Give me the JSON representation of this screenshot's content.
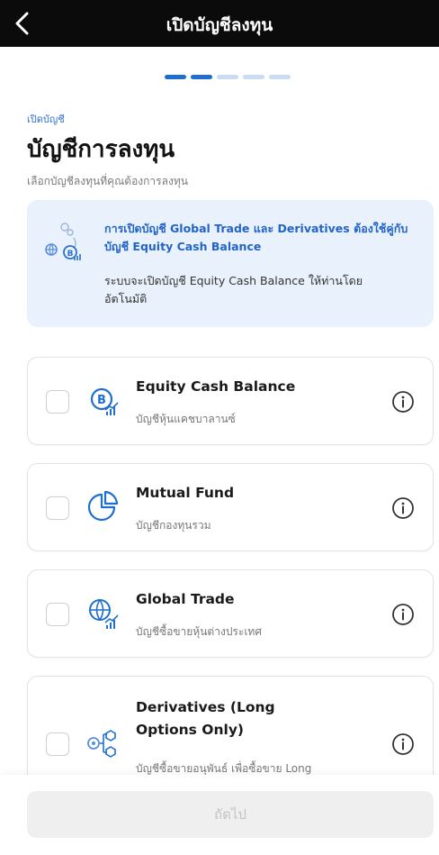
{
  "header": {
    "title": "เปิดบัญชีลงทุน"
  },
  "progress": {
    "step": 2,
    "total": 5
  },
  "page": {
    "breadcrumb": "เปิดบัญชี",
    "heading": "บัญชีการลงทุน",
    "subtitle": "เลือกบัญชีลงทุนที่คุณต้องการลงทุน"
  },
  "banner": {
    "headline": "การเปิดบัญชี Global Trade และ Derivatives ต้องใช้คู่กับบัญชี Equity Cash Balance",
    "body": "ระบบจะเปิดบัญชี Equity Cash Balance ให้ท่านโดยอัตโนมัติ"
  },
  "accounts": [
    {
      "name": "Equity Cash Balance",
      "desc": "บัญชีหุ้นแคชบาลานซ์",
      "icon": "equity-icon",
      "checked": false
    },
    {
      "name": "Mutual Fund",
      "desc": "บัญชีกองทุนรวม",
      "icon": "pie-chart-icon",
      "checked": false
    },
    {
      "name": "Global Trade",
      "desc": "บัญชีซื้อขายหุ้นต่างประเทศ",
      "icon": "globe-chart-icon",
      "checked": false
    },
    {
      "name": "Derivatives (Long Options Only)",
      "desc": "บัญชีซื้อขายอนุพันธ์ เพื่อซื้อขาย Long",
      "icon": "derivatives-icon",
      "checked": false
    }
  ],
  "footer": {
    "next_label": "ถัดไป"
  },
  "colors": {
    "accent": "#1f6fd1",
    "header_bg": "#0b0b0b",
    "banner_bg": "#e9f1fc",
    "disabled_bg": "#efefef"
  }
}
